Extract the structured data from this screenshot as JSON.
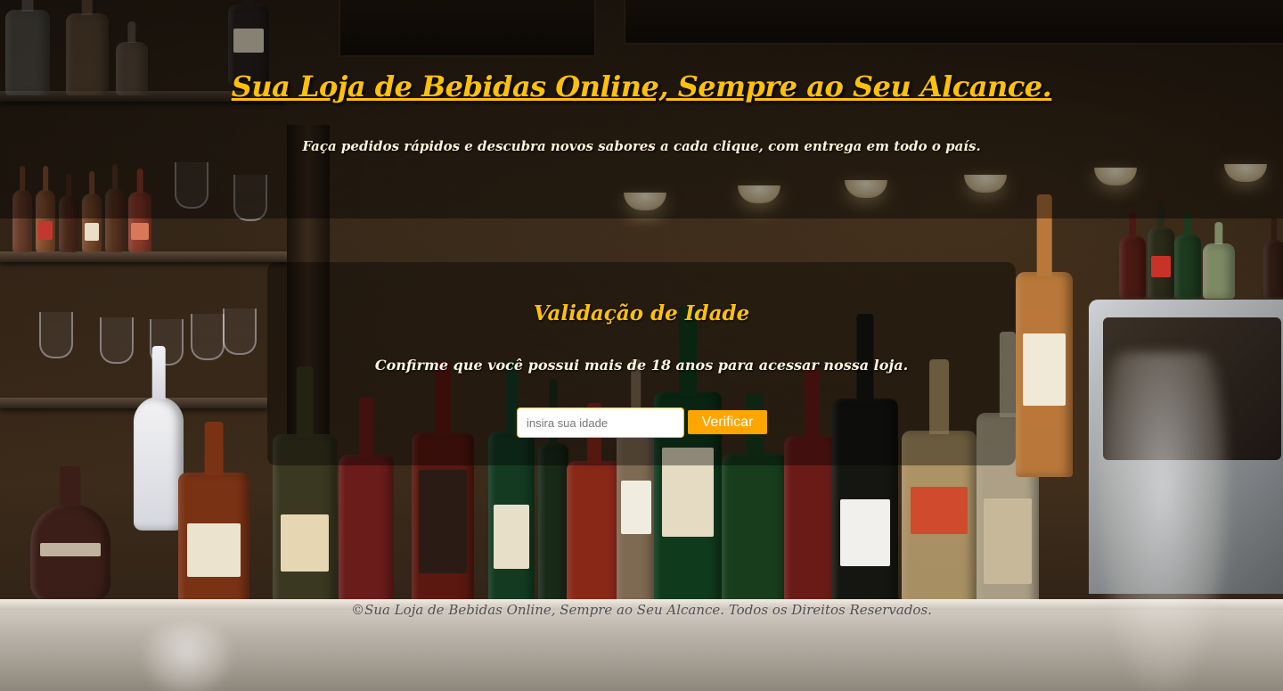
{
  "header": {
    "title": "Sua Loja de Bebidas Online, Sempre ao Seu Alcance.",
    "subtitle": "Faça pedidos rápidos e descubra novos sabores a cada clique, com entrega em todo o país."
  },
  "age_validation": {
    "title": "Validação de Idade",
    "message": "Confirme que você possui mais de 18 anos para acessar nossa loja.",
    "input_placeholder": "insira sua idade",
    "input_value": "",
    "button_label": "Verificar"
  },
  "footer": {
    "text": "©Sua Loja de Bebidas Online, Sempre ao Seu Alcance. Todos os Direitos Reservados."
  },
  "colors": {
    "accent": "#ffc107",
    "button": "#ffa500",
    "text_light": "#fff6e0"
  }
}
